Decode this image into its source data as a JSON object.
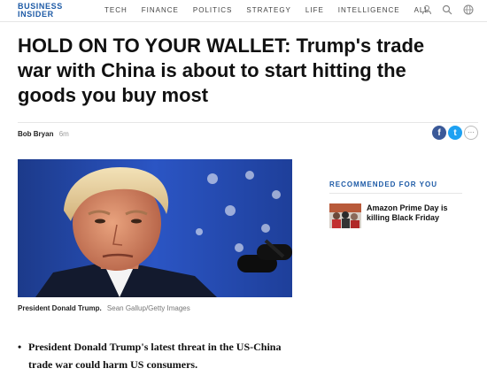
{
  "header": {
    "logo": [
      "BUSINESS",
      "INSIDER"
    ],
    "nav": [
      "TECH",
      "FINANCE",
      "POLITICS",
      "STRATEGY",
      "LIFE",
      "INTELLIGENCE",
      "ALL"
    ],
    "icons": [
      "user-icon",
      "search-icon",
      "globe-icon"
    ]
  },
  "article": {
    "headline": "HOLD ON TO YOUR WALLET: Trump's trade war with China is about to start hitting the goods you buy most",
    "author": "Bob Bryan",
    "time": "6m",
    "share": {
      "facebook_glyph": "f",
      "twitter_glyph": "t",
      "more_glyph": "···",
      "facebook_color": "#3b5998",
      "twitter_color": "#1da1f2"
    },
    "caption": "President Donald Trump.",
    "credit": "Sean Gallup/Getty Images",
    "bullets": [
      "President Donald Trump's latest threat in the US-China trade war could harm US consumers."
    ]
  },
  "sidebar": {
    "title": "RECOMMENDED FOR YOU",
    "items": [
      {
        "text": "Amazon Prime Day is killing Black Friday"
      }
    ]
  },
  "colors": {
    "brand": "#1d5aa6",
    "text": "#111111"
  }
}
